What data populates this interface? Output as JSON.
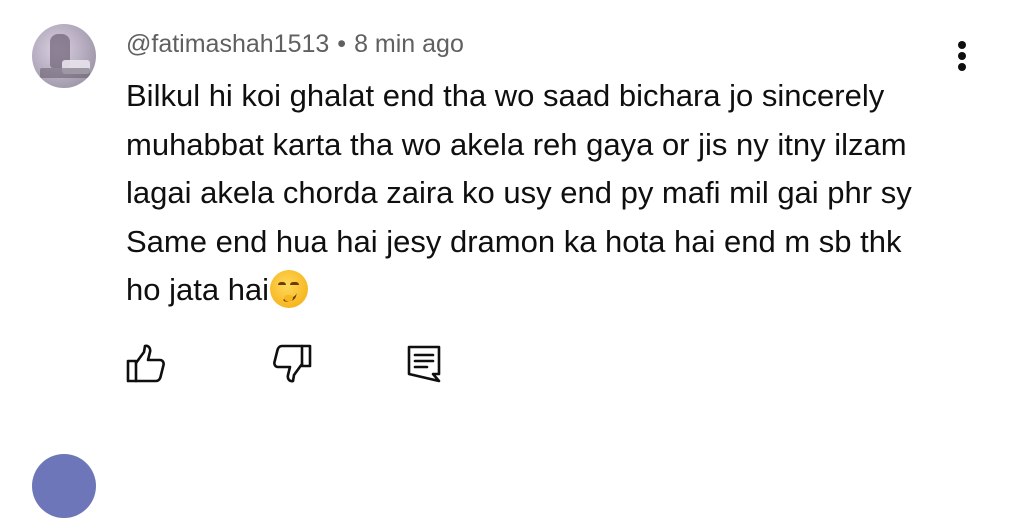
{
  "comment": {
    "author": "@fatimashah1513",
    "separator": "•",
    "timestamp": "8 min ago",
    "lines": [
      "Bilkul hi koi ghalat end tha wo saad bichara jo sincerely",
      "muhabbat karta tha wo akela reh gaya or jis ny itny ilzam",
      "lagai akela chorda zaira ko usy end py mafi mil gai phr sy",
      "Same end hua hai jesy dramon ka hota hai end m sb thk",
      "ho jata hai"
    ],
    "emoji": "smirking-face",
    "actions": {
      "like_icon": "thumbs-up-icon",
      "dislike_icon": "thumbs-down-icon",
      "reply_icon": "reply-comment-icon"
    }
  },
  "colors": {
    "text": "#0f0f0f",
    "meta": "#606060",
    "background": "#ffffff"
  }
}
